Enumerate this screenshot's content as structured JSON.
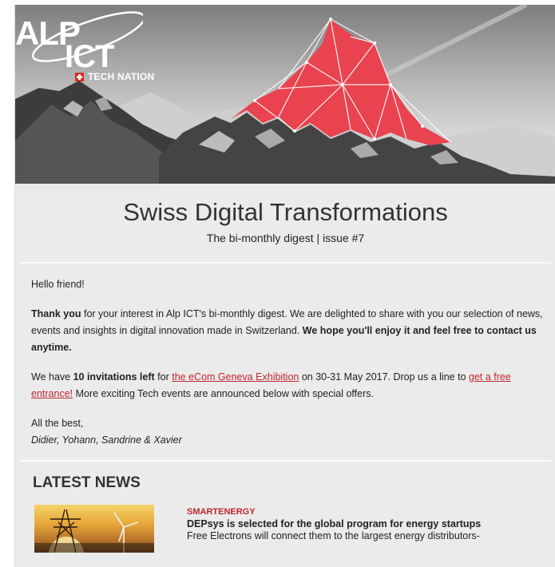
{
  "header": {
    "logo": {
      "line1": "ALP",
      "line2": "ICT",
      "tagline": "TECH NATION"
    }
  },
  "digest": {
    "title": "Swiss Digital Transformations",
    "subtitle": "The bi-monthly digest | issue #7"
  },
  "letter": {
    "greeting": "Hello friend!",
    "p1": {
      "strong1": "Thank you",
      "text1": " for your interest in Alp ICT's bi-monthly digest. We are delighted to share with you our selection of news, events and insights in digital innovation made in Switzerland. ",
      "strong2": "We hope you'll enjoy it and feel free to contact us anytime."
    },
    "p2": {
      "text1": "We have ",
      "strong1": "10 invitations left",
      "text2": " for ",
      "link1": "the eCom Geneva Exhibition",
      "text3": " on 30-31 May 2017. Drop us a line to ",
      "link2": "get a free entrance!",
      "text4": " More exciting Tech events are announced below with special offers."
    },
    "signoff": "All the best,",
    "signers": "Didier, Yohann, Sandrine & Xavier"
  },
  "latest_news": {
    "heading": "LATEST NEWS",
    "items": [
      {
        "category": "SMARTENERGY",
        "headline": "DEPsys is selected for the global program for energy startups",
        "description": "Free Electrons will connect them to the largest energy distributors-"
      }
    ]
  },
  "colors": {
    "accent": "#c0262e",
    "background": "#ebebeb",
    "hero_polygon": "#e8434f"
  }
}
